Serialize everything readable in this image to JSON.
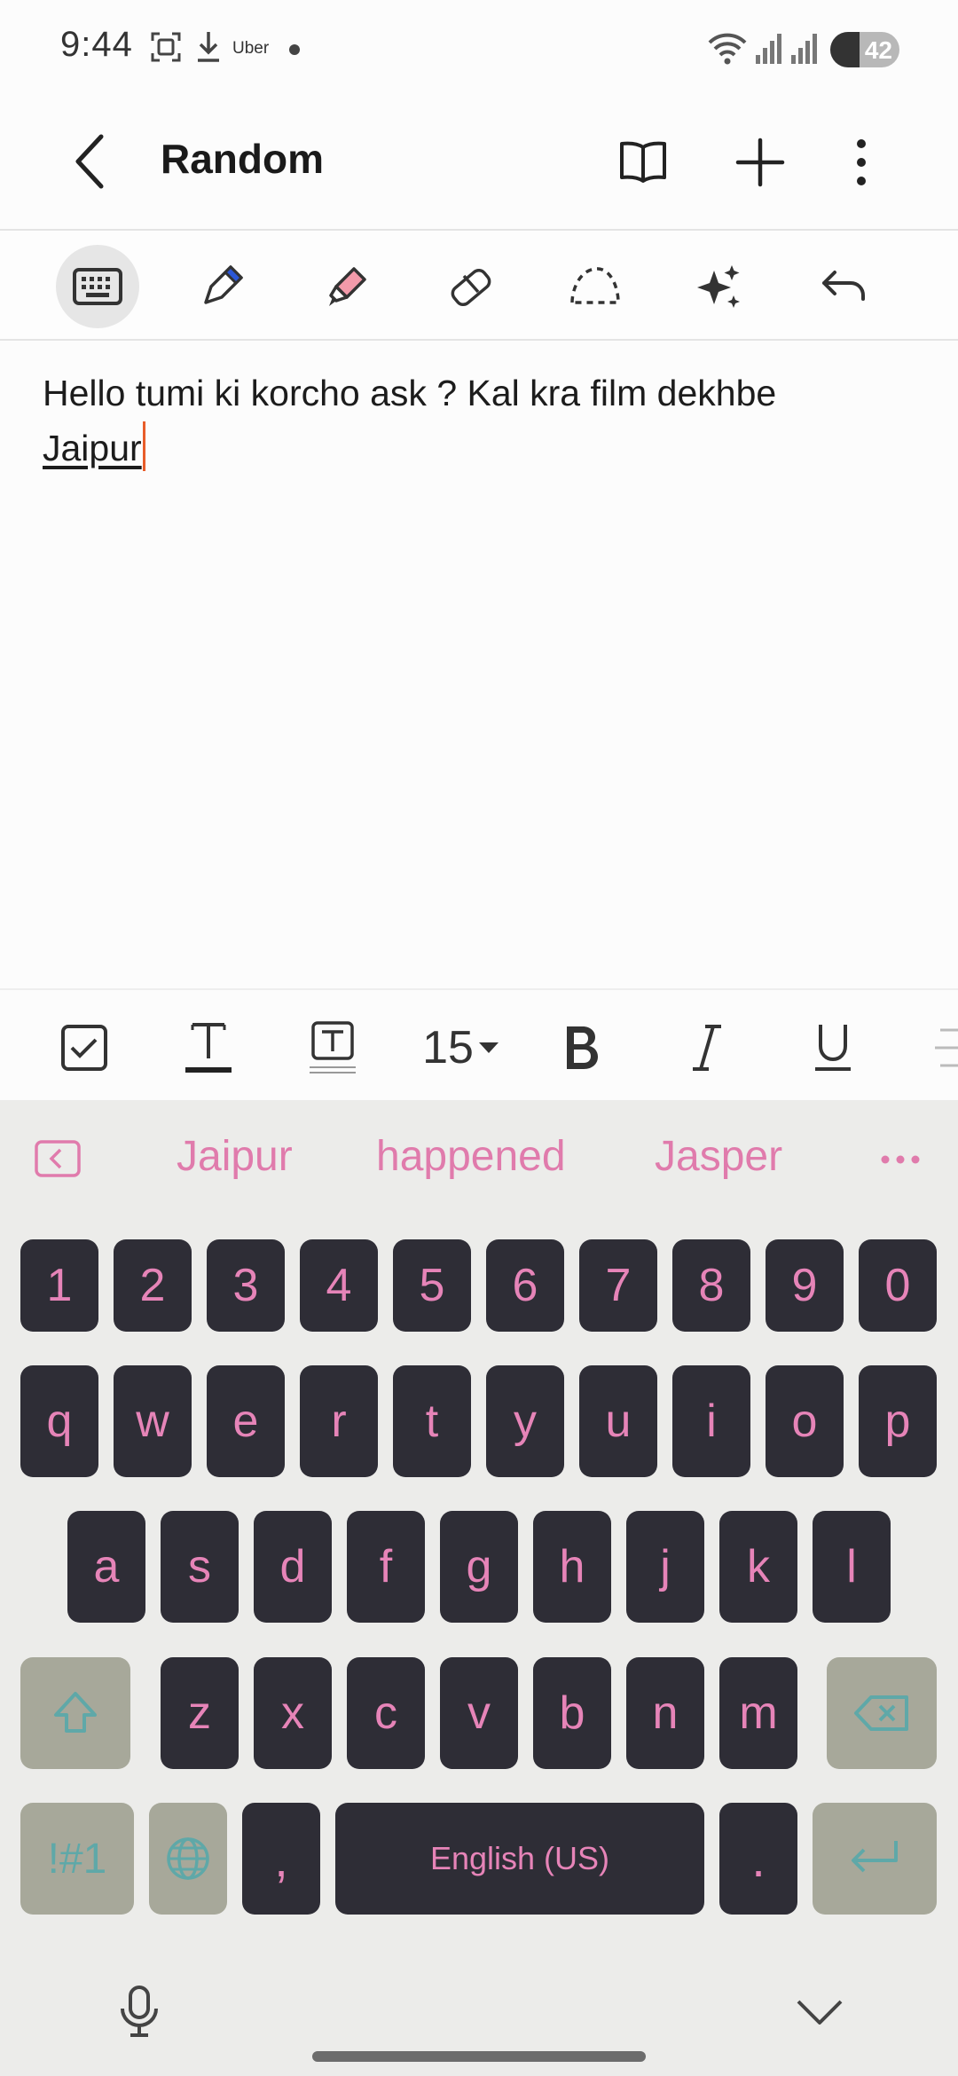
{
  "status_bar": {
    "time": "9:44",
    "notification_label": "Uber",
    "battery": "42",
    "battery_level": 0.42
  },
  "header": {
    "title": "Random"
  },
  "note": {
    "line1": "Hello tumi ki korcho ask ? Kal kra film dekhbe",
    "line2": "Jaipur"
  },
  "format_toolbar": {
    "font_size": "15"
  },
  "keyboard": {
    "suggestions": [
      "Jaipur",
      "happened",
      "Jasper"
    ],
    "number_row": [
      "1",
      "2",
      "3",
      "4",
      "5",
      "6",
      "7",
      "8",
      "9",
      "0"
    ],
    "row1": [
      "q",
      "w",
      "e",
      "r",
      "t",
      "y",
      "u",
      "i",
      "o",
      "p"
    ],
    "row2": [
      "a",
      "s",
      "d",
      "f",
      "g",
      "h",
      "j",
      "k",
      "l"
    ],
    "row3": [
      "z",
      "x",
      "c",
      "v",
      "b",
      "n",
      "m"
    ],
    "symbols_label": "!#1",
    "comma": ",",
    "space_label": "English (US)",
    "period": "."
  },
  "colors": {
    "accent_pink": "#e684b8",
    "key_dark": "#2e2d36",
    "key_fn": "#a7a89a",
    "caret": "#e85d2a"
  }
}
